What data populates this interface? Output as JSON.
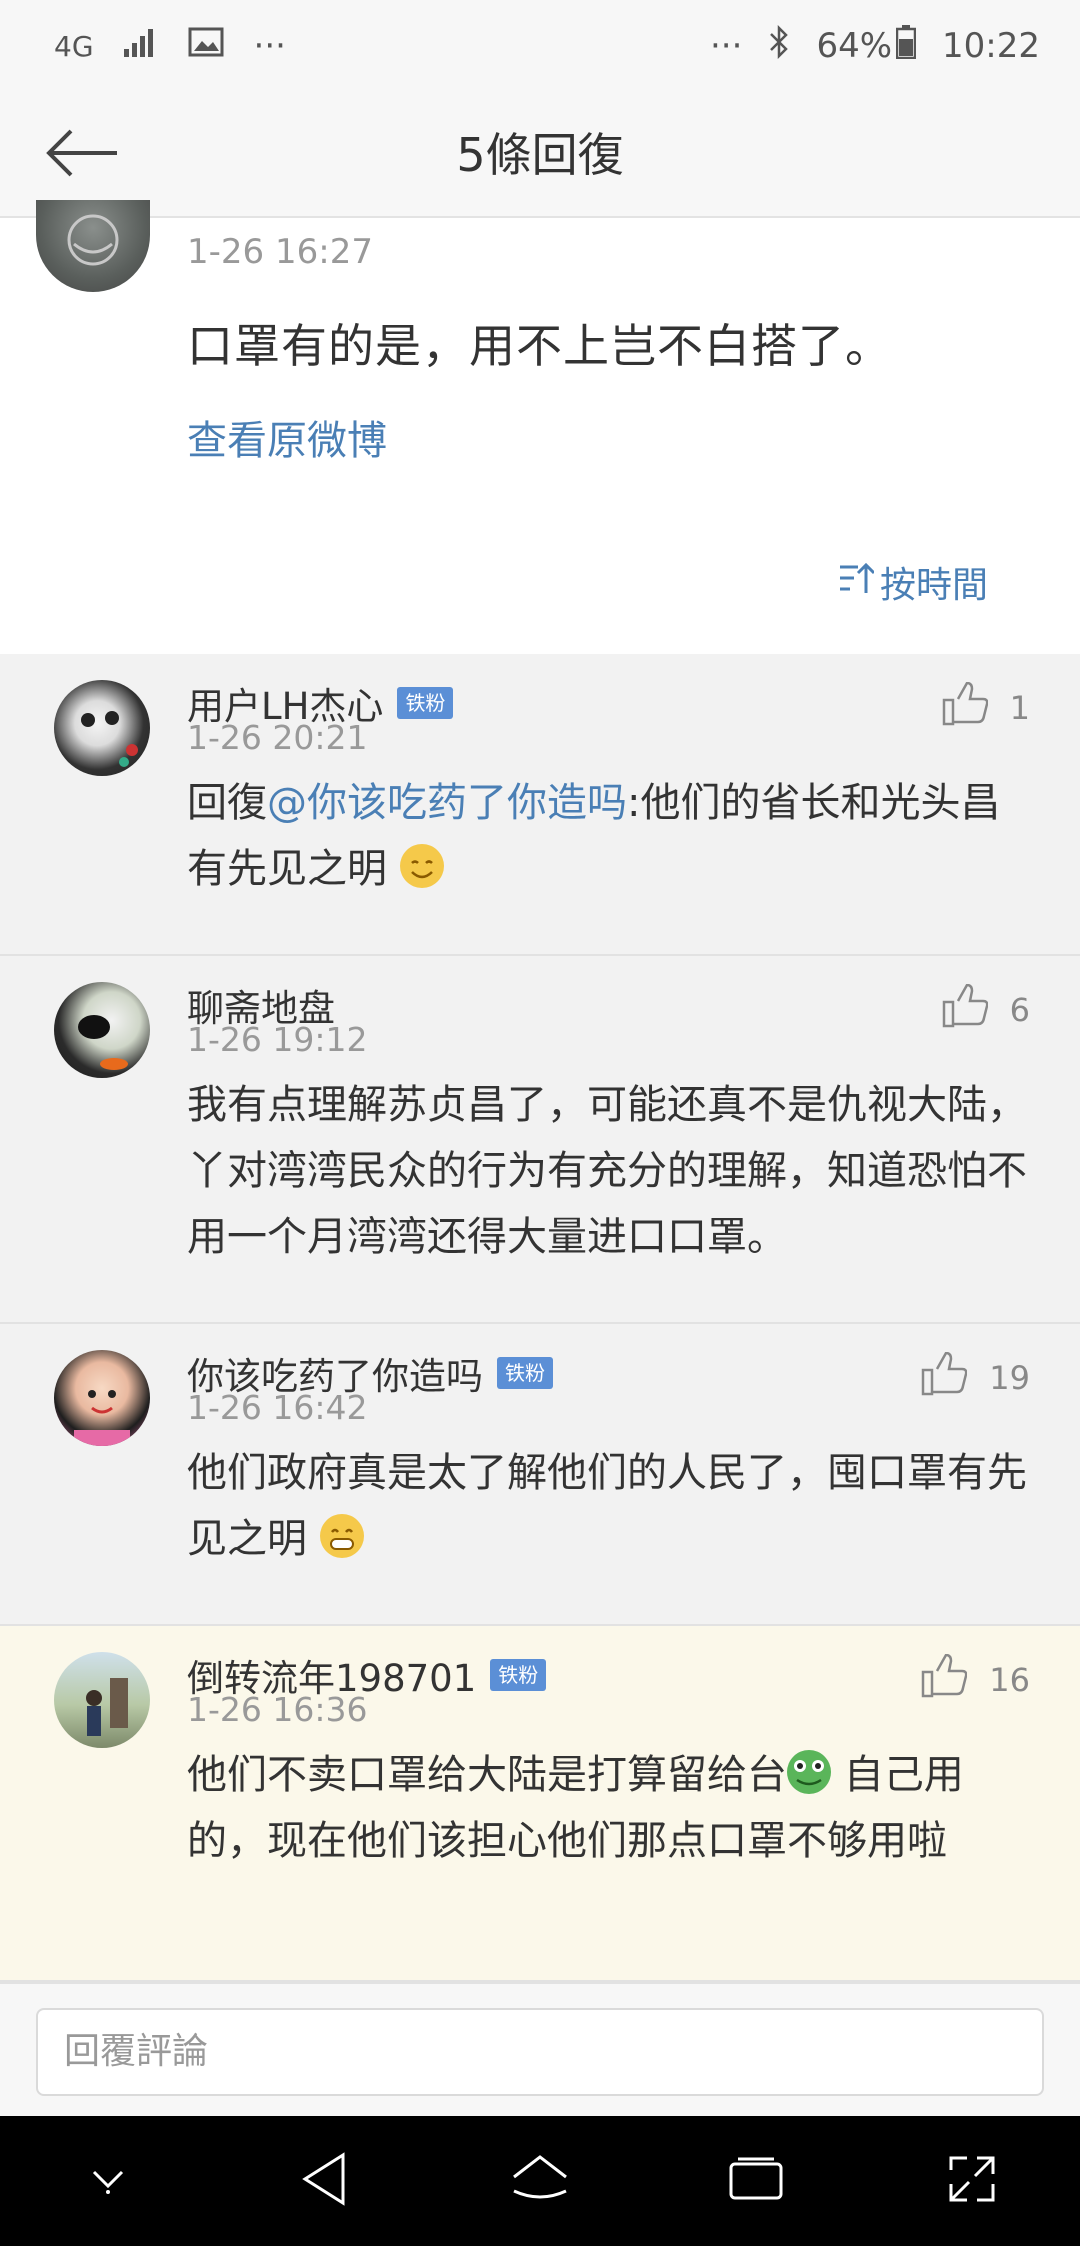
{
  "status_bar": {
    "network": "4G",
    "ellipsis_left": "···",
    "ellipsis_right": "···",
    "battery": "64%",
    "time": "10:22"
  },
  "header": {
    "title": "5條回復"
  },
  "post": {
    "time": "1-26 16:27",
    "text": "口罩有的是，用不上岂不白搭了。",
    "view_original": "查看原微博",
    "sort_label": "按時間"
  },
  "comments": [
    {
      "name": "用户LH杰心",
      "badge": "铁粉",
      "time": "1-26 20:21",
      "likes": "1",
      "reply_prefix": "回復",
      "mention": "@你该吃药了你造吗",
      "text": ":他们的省长和光头昌有先见之明"
    },
    {
      "name": "聊斋地盘",
      "time": "1-26 19:12",
      "likes": "6",
      "text": "我有点理解苏贞昌了，可能还真不是仇视大陆，丫对湾湾民众的行为有充分的理解，知道恐怕不用一个月湾湾还得大量进口口罩。"
    },
    {
      "name": "你该吃药了你造吗",
      "badge": "铁粉",
      "time": "1-26 16:42",
      "likes": "19",
      "text": "他们政府真是太了解他们的人民了，囤口罩有先见之明"
    },
    {
      "name": "倒转流年198701",
      "badge": "铁粉",
      "time": "1-26 16:36",
      "likes": "16",
      "text_a": "他们不卖口罩给大陆是打算留给台",
      "text_b": " 自己用的，现在他们该担心他们那点口罩不够用啦"
    }
  ],
  "reply_bar": {
    "placeholder": "回覆評論"
  },
  "icons": {
    "back": "arrow-left-icon",
    "sort": "sort-icon",
    "like": "thumbs-up-icon"
  },
  "colors": {
    "link": "#4a7fb5",
    "badge": "#5b8fd6",
    "highlight_bg": "#fbf8ea"
  }
}
